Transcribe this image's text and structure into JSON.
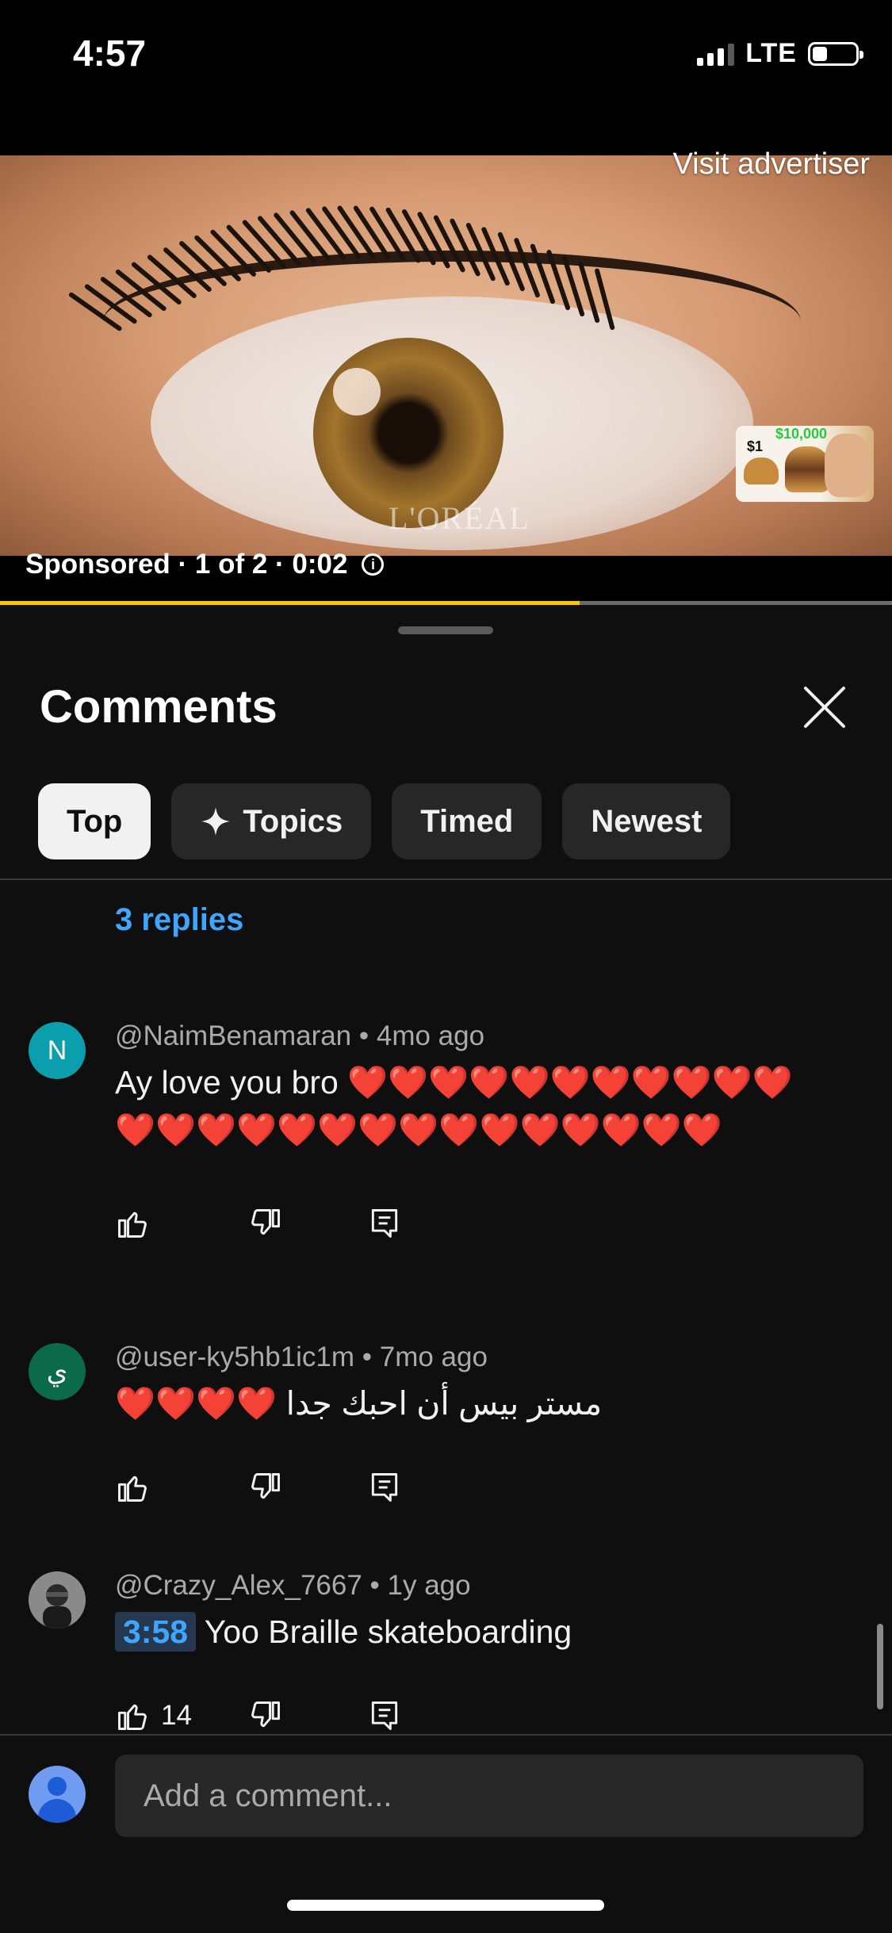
{
  "status_bar": {
    "time": "4:57",
    "network": "LTE",
    "battery_level": 0.3
  },
  "ad": {
    "visit_advertiser": "Visit advertiser",
    "brand_watermark": "L'ORÉAL",
    "sponsored_text": "Sponsored · 1 of 2 · 0:02",
    "progress_fraction": 0.65,
    "promo_thumb_prices": [
      "$1",
      "$10,000"
    ]
  },
  "comments_panel": {
    "title": "Comments",
    "filters": [
      {
        "label": "Top",
        "active": true
      },
      {
        "label": "Topics",
        "active": false,
        "icon": "sparkle-icon"
      },
      {
        "label": "Timed",
        "active": false
      },
      {
        "label": "Newest",
        "active": false
      }
    ],
    "replies_link": "3 replies",
    "comments": [
      {
        "avatar_letter": "N",
        "avatar_color": "#0b9fad",
        "author": "@NaimBenamaran",
        "age": "4mo ago",
        "text": "Ay love you bro ❤️❤️❤️❤️❤️❤️❤️❤️❤️❤️❤️❤️❤️❤️❤️❤️❤️❤️❤️❤️❤️❤️❤️❤️❤️❤️",
        "likes": ""
      },
      {
        "avatar_letter": "ي",
        "avatar_color": "#0b6a4a",
        "author": "@user-ky5hb1ic1m",
        "age": "7mo ago",
        "text": "❤️❤️❤️❤️ مستر بيس أن احبك جدا",
        "likes": ""
      },
      {
        "avatar_letter": "",
        "avatar_color": "#6b6b6b",
        "author": "@Crazy_Alex_7667",
        "age": "1y ago",
        "timestamp": "3:58",
        "text": "Yoo Braille skateboarding",
        "likes": "14"
      }
    ],
    "composer_placeholder": "Add a comment..."
  },
  "colors": {
    "accent_link": "#3ea6ff",
    "progress": "#f9c800",
    "background": "#0f0f0f"
  }
}
